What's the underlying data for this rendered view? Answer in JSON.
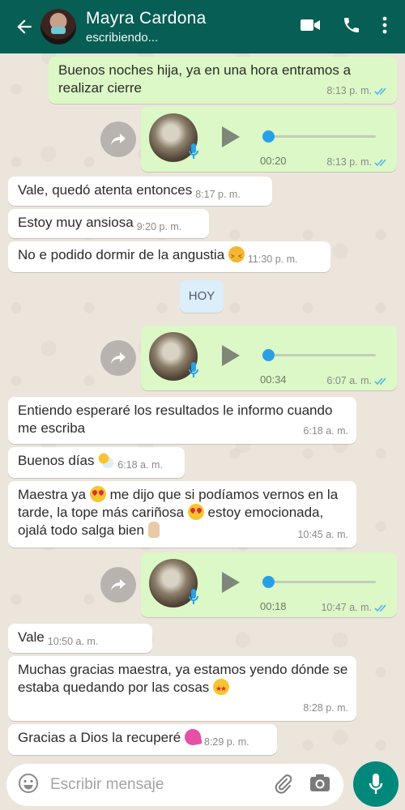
{
  "header": {
    "contact_name": "Mayra Cardona",
    "status": "escribiendo..."
  },
  "messages": [
    {
      "id": "m1",
      "dir": "out",
      "text": "Buenos noches hija, ya en una hora entramos a realizar cierre",
      "time": "8:13 p. m."
    },
    {
      "id": "v1",
      "dir": "out",
      "type": "voice",
      "duration": "00:20",
      "time": "8:13 p. m."
    },
    {
      "id": "m2",
      "dir": "in",
      "text": "Vale, quedó atenta entonces",
      "time": "8:17 p. m."
    },
    {
      "id": "m3",
      "dir": "in",
      "text": "Estoy muy ansiosa",
      "time": "9:20 p. m."
    },
    {
      "id": "m4",
      "dir": "in",
      "text": "No e podido dormir de la angustia",
      "emoji": "tired-face",
      "time": "11:30 p. m."
    },
    {
      "id": "v2",
      "dir": "out",
      "type": "voice",
      "duration": "00:34",
      "time": "6:07 a. m."
    },
    {
      "id": "m5",
      "dir": "in",
      "text": "Entiendo esperaré los resultados le informo cuando me escriba",
      "time": "6:18 a. m."
    },
    {
      "id": "m6",
      "dir": "in",
      "text": "Buenos días",
      "emoji": "sun-behind-cloud",
      "time": "6:18 a. m."
    },
    {
      "id": "m7",
      "dir": "in",
      "text_a": "Maestra ya",
      "text_b": "me dijo que si podíamos vernos en la tarde, la tope más cariñosa",
      "text_c": "estoy emocionada, ojalá todo salga bien",
      "time": "10:45 a. m."
    },
    {
      "id": "v3",
      "dir": "out",
      "type": "voice",
      "duration": "00:18",
      "time": "10:47 a. m."
    },
    {
      "id": "m8",
      "dir": "in",
      "text": "Vale",
      "time": "10:50 a. m."
    },
    {
      "id": "m9",
      "dir": "in",
      "text": "Muchas gracias maestra, ya estamos yendo dónde se estaba quedando por las cosas",
      "emoji": "star-struck",
      "time": "8:28 p. m."
    },
    {
      "id": "m10",
      "dir": "in",
      "text": "Gracias a Dios la recuperé",
      "emoji": "two-hearts",
      "time": "8:29 p. m."
    }
  ],
  "day_separator": "HOY",
  "composer": {
    "placeholder": "Escribir mensaje"
  },
  "colors": {
    "header": "#075e54",
    "outgoing_bubble": "#dcf8c6",
    "incoming_bubble": "#ffffff",
    "read_tick": "#4fb6ec",
    "voice_knob": "#27a0e6",
    "send_button": "#00897b"
  }
}
